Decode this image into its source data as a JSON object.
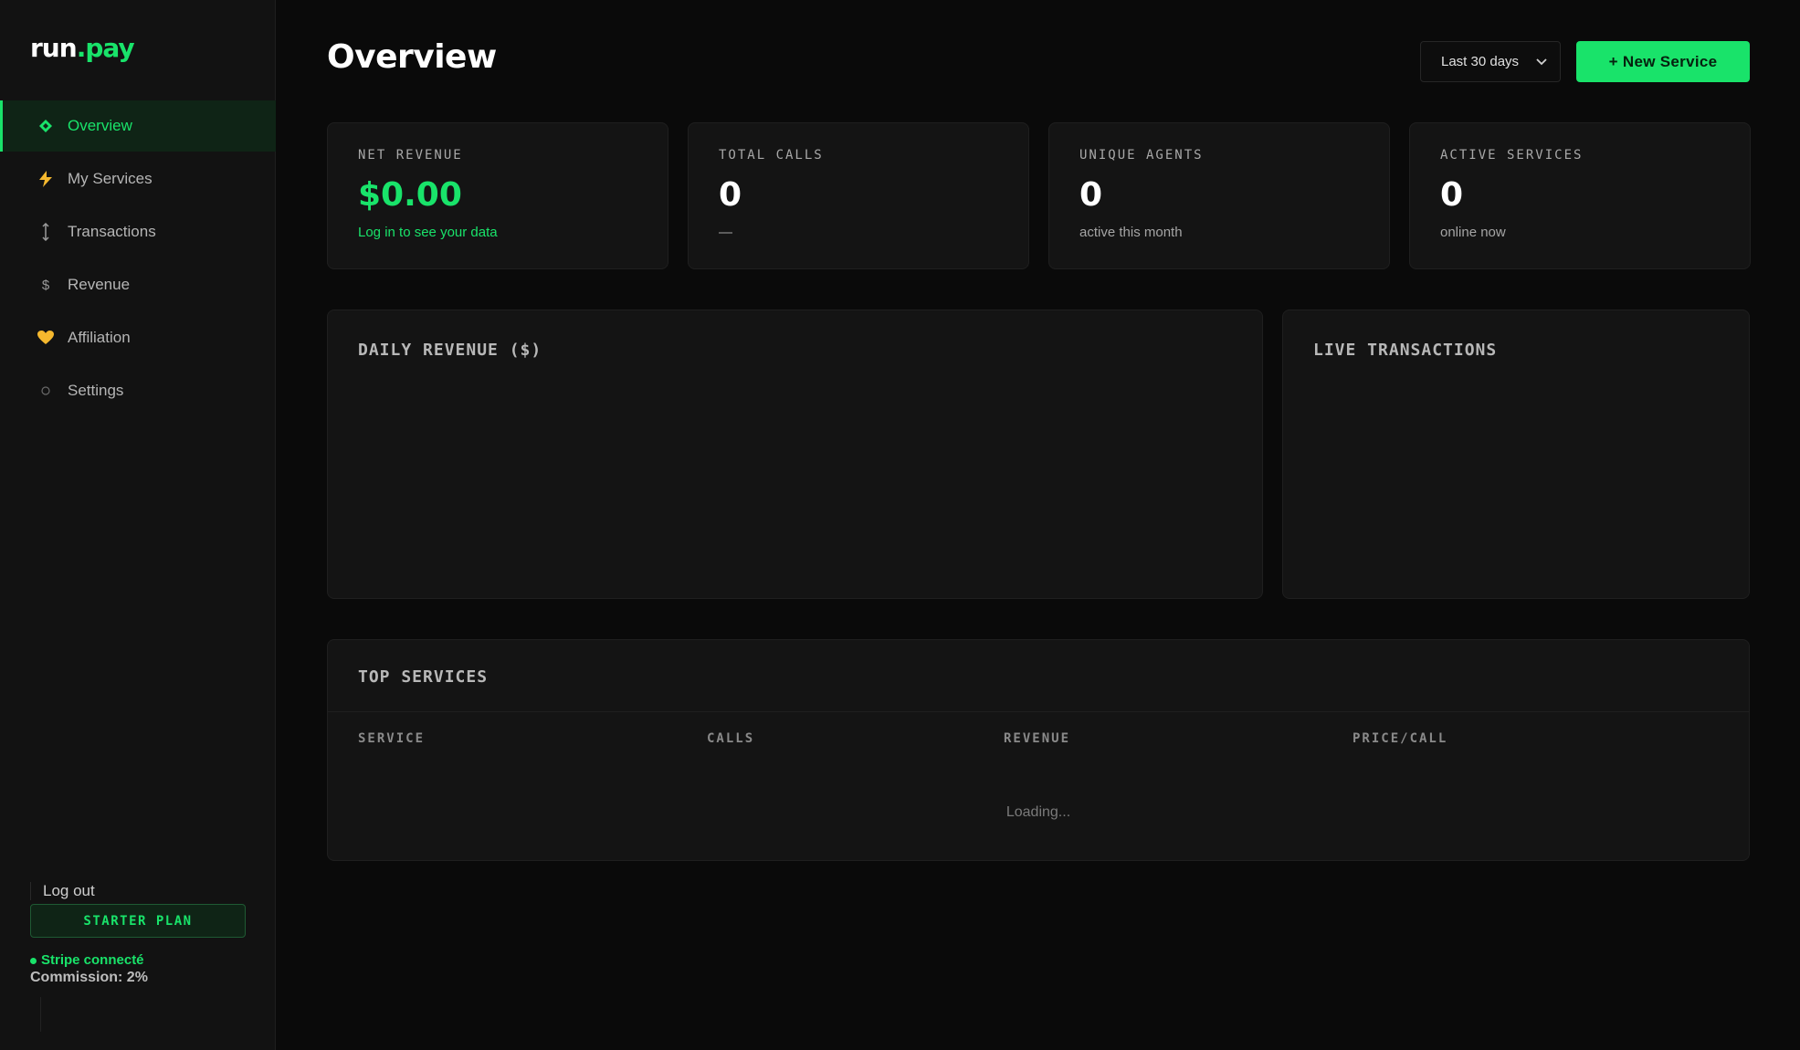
{
  "brand": {
    "logo_main": "run",
    "logo_dot": ".",
    "logo_accent": "pay"
  },
  "sidebar": {
    "items": [
      {
        "label": "Overview",
        "icon": "diamond-icon",
        "active": true
      },
      {
        "label": "My Services",
        "icon": "lightning-icon"
      },
      {
        "label": "Transactions",
        "icon": "updown-arrow-icon"
      },
      {
        "label": "Revenue",
        "icon": "dollar-icon"
      },
      {
        "label": "Affiliation",
        "icon": "heart-icon"
      },
      {
        "label": "Settings",
        "icon": "circle-icon"
      }
    ],
    "logout_label": "Log out",
    "plan_label": "STARTER PLAN",
    "stripe_status": "Stripe connecté",
    "commission": "Commission: 2%"
  },
  "header": {
    "title": "Overview",
    "range_value": "Last 30 days",
    "new_service_label": "+ New Service"
  },
  "stats": [
    {
      "label": "NET REVENUE",
      "value": "$0.00",
      "sub": "Log in to see your data"
    },
    {
      "label": "TOTAL CALLS",
      "value": "0",
      "sub": "—"
    },
    {
      "label": "UNIQUE AGENTS",
      "value": "0",
      "sub": "active this month"
    },
    {
      "label": "ACTIVE SERVICES",
      "value": "0",
      "sub": "online now"
    }
  ],
  "panels": {
    "daily_revenue_title": "DAILY REVENUE ($)",
    "live_transactions_title": "LIVE TRANSACTIONS"
  },
  "top_services": {
    "title": "TOP SERVICES",
    "columns": [
      "SERVICE",
      "CALLS",
      "REVENUE",
      "PRICE/CALL"
    ],
    "loading_text": "Loading..."
  },
  "colors": {
    "accent": "#19e36a",
    "background": "#0a0a0a",
    "card": "#141414"
  }
}
